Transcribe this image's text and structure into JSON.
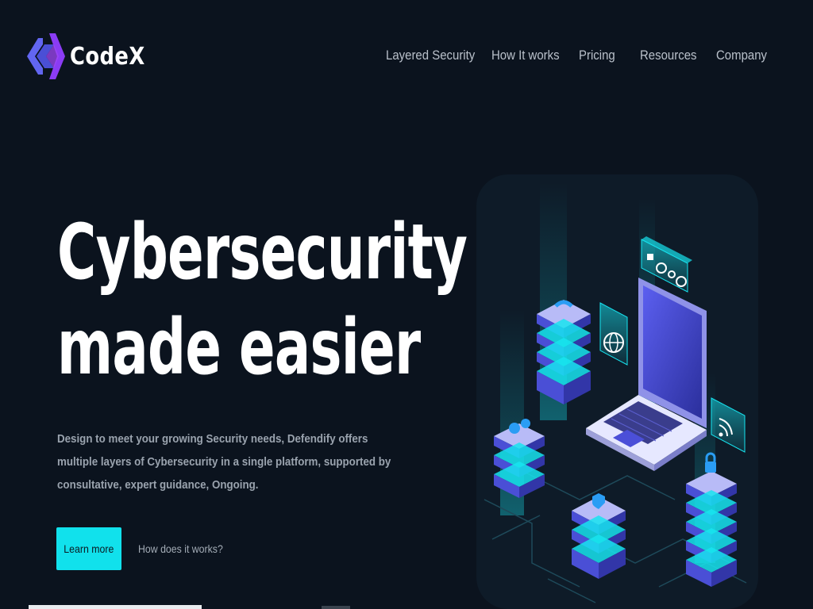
{
  "brand": {
    "name": "CodeX",
    "logo_icon": "codex-chevron-logo",
    "colors": {
      "logo_left": "#5a5ef0",
      "logo_right": "#8a3df5"
    }
  },
  "nav": {
    "items": [
      {
        "label": "Layered Security"
      },
      {
        "label": "How It works"
      },
      {
        "label": "Pricing"
      },
      {
        "label": "Resources"
      },
      {
        "label": "Company"
      }
    ]
  },
  "hero": {
    "title_line1": "Cybersecurity",
    "title_line2": "made easier",
    "description": "Design to meet your growing Security needs, Defendify offers multiple layers of Cybersecurity in a single platform, supported by consultative, expert guidance, Ongoing.",
    "primary_cta": "Learn more",
    "secondary_cta": "How does it works?"
  },
  "illustration": {
    "subject": "isometric laptop with server stacks and security icons",
    "icons": [
      "laptop-icon",
      "server-stack-icon",
      "globe-icon",
      "shield-icon",
      "lock-icon",
      "gear-icon",
      "refresh-icon",
      "wifi-icon"
    ]
  },
  "colors": {
    "background": "#0b131e",
    "accent": "#11e1ec",
    "text_primary": "#ffffff",
    "text_muted": "#9aa3ae",
    "nav_text": "#b9c0ca"
  }
}
